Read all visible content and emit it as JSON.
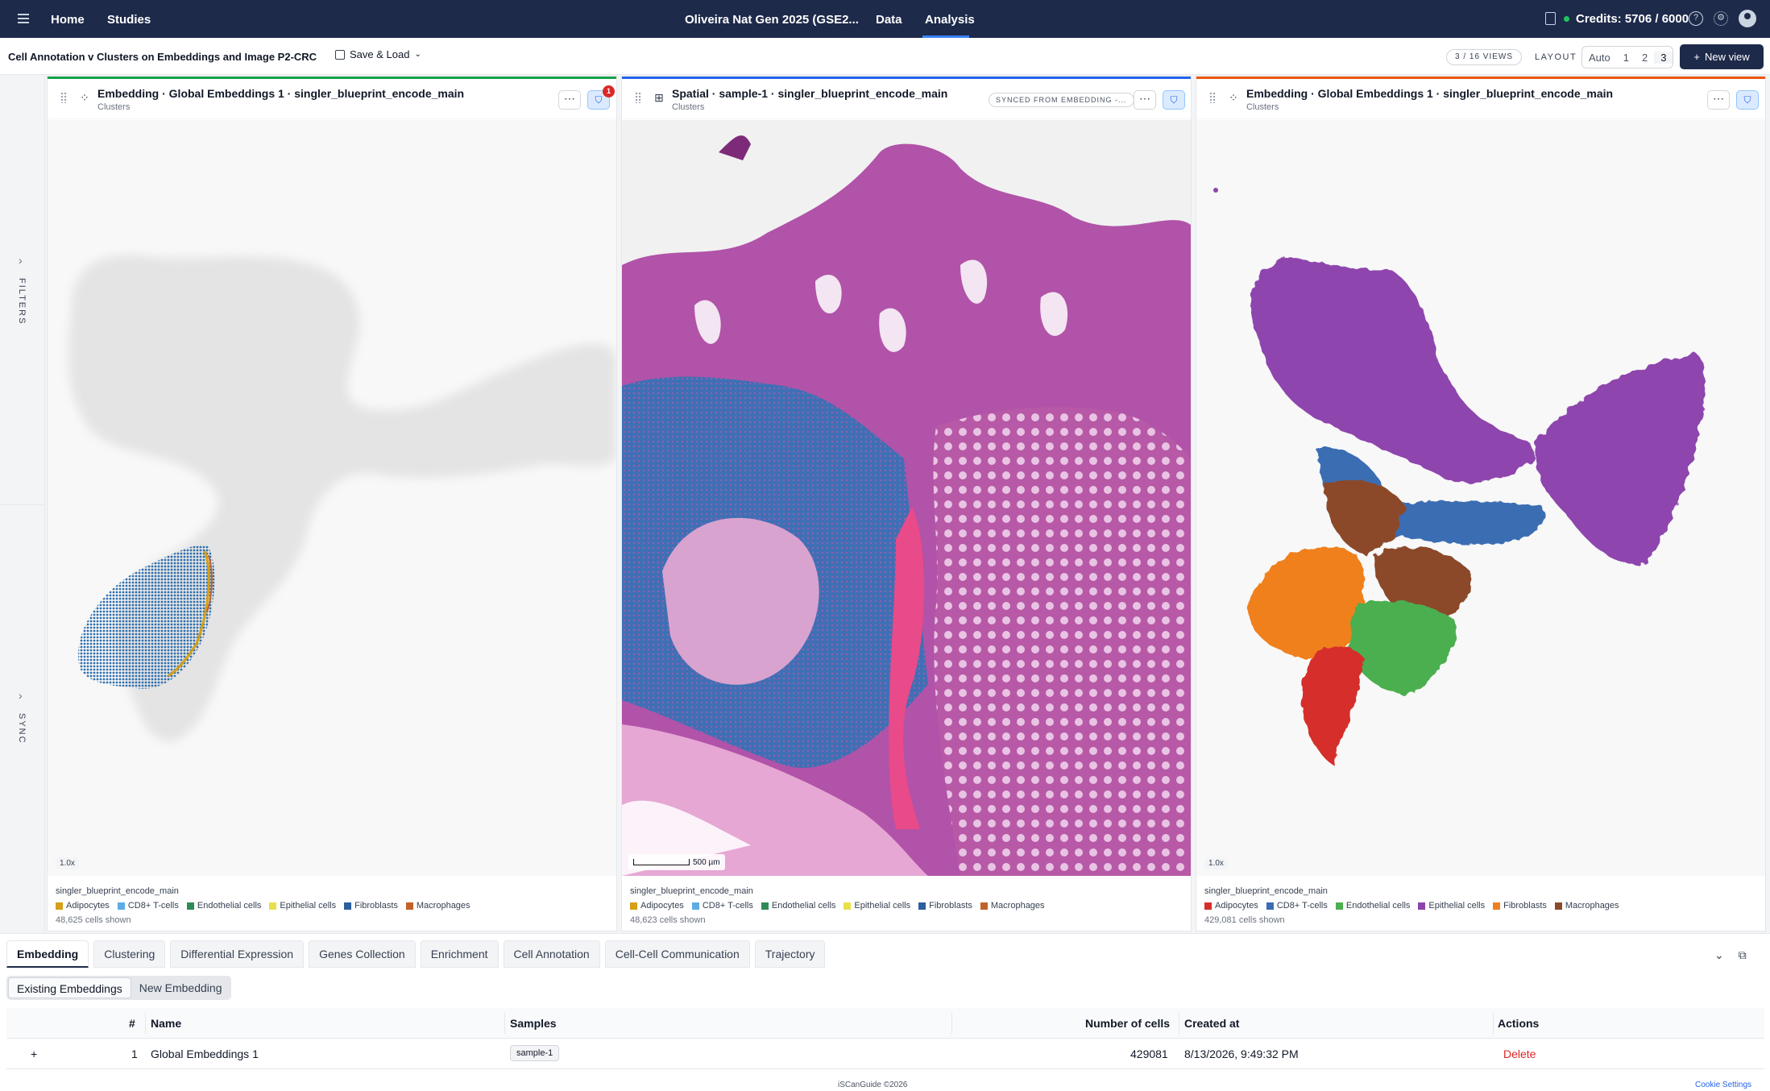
{
  "nav": {
    "home": "Home",
    "studies": "Studies",
    "study_title": "Oliveira Nat Gen 2025 (GSE2...",
    "data": "Data",
    "analysis": "Analysis",
    "credits": "Credits: 5706 / 6000"
  },
  "toolbar": {
    "page_title": "Cell Annotation v Clusters on Embeddings and Image P2-CRC",
    "save_load": "Save & Load",
    "views_count": "3 / 16 VIEWS",
    "layout_label": "LAYOUT",
    "layout_options": [
      "Auto",
      "1",
      "2",
      "3"
    ],
    "layout_selected": "3",
    "new_view": "New view"
  },
  "sidebar": {
    "filters": "FILTERS",
    "sync": "SYNC"
  },
  "panels": [
    {
      "title": "Embedding · Global Embeddings 1 · singler_blueprint_encode_main",
      "subtitle": "Clusters",
      "filter_badge": "1",
      "accent_color": "#16a34a",
      "zoom": "1.0x",
      "legend_title": "singler_blueprint_encode_main",
      "cells_shown": "48,625 cells shown"
    },
    {
      "title": "Spatial · sample-1 · singler_blueprint_encode_main",
      "subtitle": "Clusters",
      "synced_label": "SYNCED FROM EMBEDDING -...",
      "accent_color": "#2563eb",
      "scale_bar": "500 µm",
      "legend_title": "singler_blueprint_encode_main",
      "cells_shown": "48,623 cells shown"
    },
    {
      "title": "Embedding · Global Embeddings 1 · singler_blueprint_encode_main",
      "subtitle": "Clusters",
      "accent_color": "#ea580c",
      "zoom": "1.0x",
      "legend_title": "singler_blueprint_encode_main",
      "cells_shown": "429,081 cells shown"
    }
  ],
  "legend_labels": [
    "Adipocytes",
    "CD8+ T-cells",
    "Endothelial cells",
    "Epithelial cells",
    "Fibroblasts",
    "Macrophages"
  ],
  "legend_colors_filtered": [
    "#d4a017",
    "#5dade2",
    "#2e8b57",
    "#e8e04a",
    "#2c5f9e",
    "#c0622a"
  ],
  "legend_colors_full": [
    "#d62f2a",
    "#3a6db3",
    "#4caf50",
    "#8e44ad",
    "#f0801f",
    "#8b4a2a"
  ],
  "bottom": {
    "tabs": [
      "Embedding",
      "Clustering",
      "Differential Expression",
      "Genes Collection",
      "Enrichment",
      "Cell Annotation",
      "Cell-Cell Communication",
      "Trajectory"
    ],
    "active_tab": "Embedding",
    "subtabs": [
      "Existing Embeddings",
      "New Embedding"
    ],
    "table": {
      "headers": [
        "#",
        "Name",
        "Samples",
        "Number of cells",
        "Created at",
        "Actions"
      ],
      "rows": [
        {
          "index": "1",
          "name": "Global Embeddings 1",
          "sample": "sample-1",
          "cells": "429081",
          "created": "8/13/2026, 9:49:32 PM",
          "action": "Delete"
        }
      ]
    }
  },
  "footer": {
    "copyright": "iSCanGuide ©2026",
    "cookie": "Cookie Settings"
  }
}
